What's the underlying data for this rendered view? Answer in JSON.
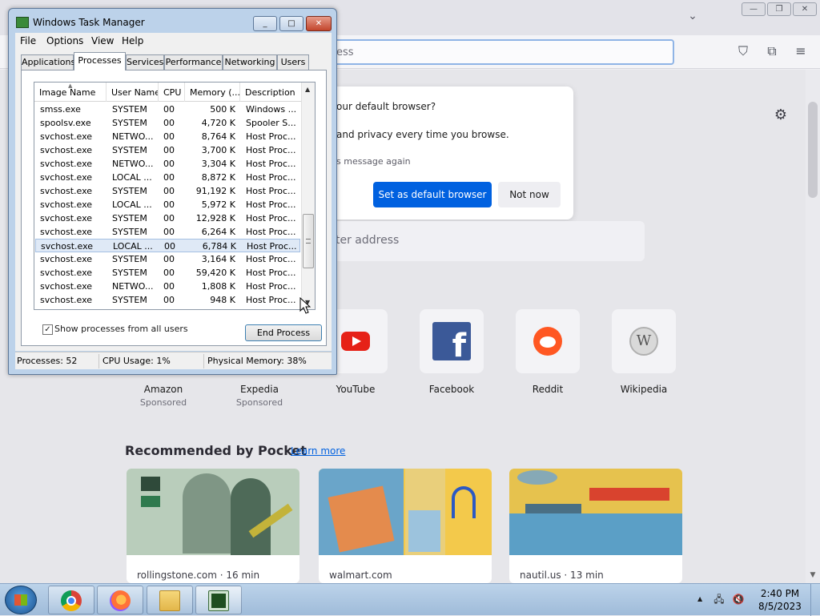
{
  "taskmgr": {
    "title": "Windows Task Manager",
    "window_buttons": {
      "minimize": "_",
      "maximize": "□",
      "close": "✕"
    },
    "menu": [
      "File",
      "Options",
      "View",
      "Help"
    ],
    "tabs": [
      "Applications",
      "Processes",
      "Services",
      "Performance",
      "Networking",
      "Users"
    ],
    "active_tab": "Processes",
    "columns": [
      "Image Name",
      "User Name",
      "CPU",
      "Memory (...",
      "Description"
    ],
    "rows": [
      {
        "name": "smss.exe",
        "user": "SYSTEM",
        "cpu": "00",
        "mem": "500 K",
        "desc": "Windows ..."
      },
      {
        "name": "spoolsv.exe",
        "user": "SYSTEM",
        "cpu": "00",
        "mem": "4,720 K",
        "desc": "Spooler S..."
      },
      {
        "name": "svchost.exe",
        "user": "NETWO...",
        "cpu": "00",
        "mem": "8,764 K",
        "desc": "Host Proc..."
      },
      {
        "name": "svchost.exe",
        "user": "SYSTEM",
        "cpu": "00",
        "mem": "3,700 K",
        "desc": "Host Proc..."
      },
      {
        "name": "svchost.exe",
        "user": "NETWO...",
        "cpu": "00",
        "mem": "3,304 K",
        "desc": "Host Proc..."
      },
      {
        "name": "svchost.exe",
        "user": "LOCAL ...",
        "cpu": "00",
        "mem": "8,872 K",
        "desc": "Host Proc..."
      },
      {
        "name": "svchost.exe",
        "user": "SYSTEM",
        "cpu": "00",
        "mem": "91,192 K",
        "desc": "Host Proc..."
      },
      {
        "name": "svchost.exe",
        "user": "LOCAL ...",
        "cpu": "00",
        "mem": "5,972 K",
        "desc": "Host Proc..."
      },
      {
        "name": "svchost.exe",
        "user": "SYSTEM",
        "cpu": "00",
        "mem": "12,928 K",
        "desc": "Host Proc..."
      },
      {
        "name": "svchost.exe",
        "user": "SYSTEM",
        "cpu": "00",
        "mem": "6,264 K",
        "desc": "Host Proc..."
      },
      {
        "name": "svchost.exe",
        "user": "LOCAL ...",
        "cpu": "00",
        "mem": "6,784 K",
        "desc": "Host Proc..."
      },
      {
        "name": "svchost.exe",
        "user": "SYSTEM",
        "cpu": "00",
        "mem": "3,164 K",
        "desc": "Host Proc..."
      },
      {
        "name": "svchost.exe",
        "user": "SYSTEM",
        "cpu": "00",
        "mem": "59,420 K",
        "desc": "Host Proc..."
      },
      {
        "name": "svchost.exe",
        "user": "NETWO...",
        "cpu": "00",
        "mem": "1,808 K",
        "desc": "Host Proc..."
      },
      {
        "name": "svchost.exe",
        "user": "SYSTEM",
        "cpu": "00",
        "mem": "948 K",
        "desc": "Host Proc..."
      }
    ],
    "selected_row_index": 10,
    "show_all_users_label": "Show processes from all users",
    "show_all_users_checked": "✓",
    "end_process_label": "End Process",
    "status": {
      "processes": "Processes: 52",
      "cpu": "CPU Usage: 1%",
      "memory": "Physical Memory: 38%"
    }
  },
  "browser": {
    "urlbar_visible_text": "ess",
    "notification": {
      "question_fragment": "our default browser?",
      "privacy_fragment": "and privacy every time you browse.",
      "dont_show_fragment": "s message again",
      "primary_button": "Set as default browser",
      "secondary_button": "Not now"
    },
    "search_placeholder_fragment": "ter address",
    "top_sites": [
      {
        "label": "Amazon",
        "sponsored": "Sponsored",
        "icon": "amazon-icon"
      },
      {
        "label": "Expedia",
        "sponsored": "Sponsored",
        "icon": "expedia-icon"
      },
      {
        "label": "YouTube",
        "sponsored": "",
        "icon": "youtube-icon"
      },
      {
        "label": "Facebook",
        "sponsored": "",
        "icon": "facebook-icon"
      },
      {
        "label": "Reddit",
        "sponsored": "",
        "icon": "reddit-icon"
      },
      {
        "label": "Wikipedia",
        "sponsored": "",
        "icon": "wikipedia-icon"
      }
    ],
    "pocket": {
      "title": "Recommended by Pocket",
      "learn_more": "Learn more",
      "cards": [
        {
          "source": "rollingstone.com · 16 min"
        },
        {
          "source": "walmart.com"
        },
        {
          "source": "nautil.us · 13 min"
        }
      ]
    },
    "accent_color": "#0061e0"
  },
  "taskbar": {
    "time": "2:40 PM",
    "date": "8/5/2023",
    "apps": [
      "chrome-icon",
      "firefox-icon",
      "file-explorer-icon",
      "task-manager-icon"
    ]
  }
}
